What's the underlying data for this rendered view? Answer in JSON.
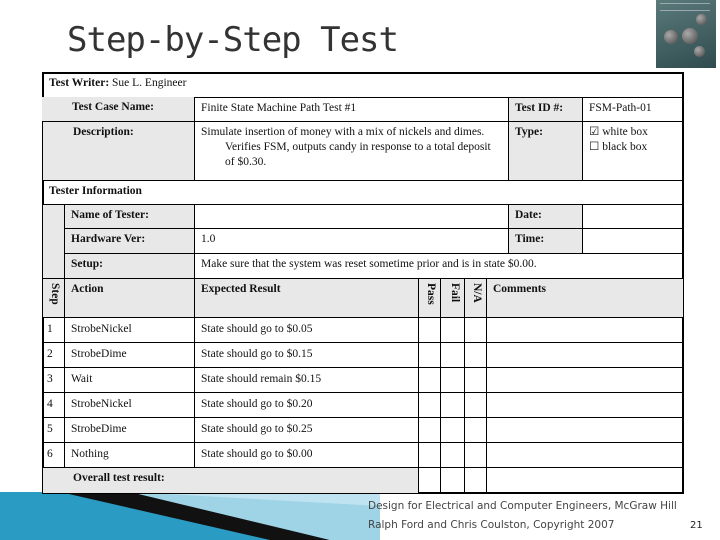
{
  "title": "Step-by-Step Test",
  "test_writer": {
    "label": "Test Writer:",
    "value": "Sue L. Engineer"
  },
  "test_case_name": {
    "label": "Test Case Name:",
    "value": "Finite State Machine Path Test #1"
  },
  "test_id": {
    "label": "Test ID #:",
    "value": "FSM-Path-01"
  },
  "description": {
    "label": "Description:",
    "value": "Simulate insertion of money with a mix of nickels and dimes. Verifies FSM, outputs candy in response to a total deposit of $0.30."
  },
  "type": {
    "label": "Type:",
    "options": [
      {
        "label": "white box",
        "checked": true,
        "box": "☑"
      },
      {
        "label": "black box",
        "checked": false,
        "box": "☐"
      }
    ]
  },
  "tester_info": {
    "label": "Tester Information",
    "name_label": "Name of Tester:",
    "name_value": "",
    "date_label": "Date:",
    "date_value": "",
    "hardware_label": "Hardware Ver:",
    "hardware_value": "1.0",
    "time_label": "Time:",
    "time_value": "",
    "setup_label": "Setup:",
    "setup_value": "Make sure that the system was reset sometime prior and is in state $0.00."
  },
  "steps_table": {
    "headers": {
      "step": "Step",
      "action": "Action",
      "expected": "Expected Result",
      "pass": "Pass",
      "fail": "Fail",
      "na": "N/A",
      "comments": "Comments"
    },
    "rows": [
      {
        "step": "1",
        "action": "StrobeNickel",
        "expected": "State should go to $0.05"
      },
      {
        "step": "2",
        "action": "StrobeDime",
        "expected": "State should go to $0.15"
      },
      {
        "step": "3",
        "action": "Wait",
        "expected": "State should remain $0.15"
      },
      {
        "step": "4",
        "action": "StrobeNickel",
        "expected": "State should go to $0.20"
      },
      {
        "step": "5",
        "action": "StrobeDime",
        "expected": "State should go to $0.25"
      },
      {
        "step": "6",
        "action": "Nothing",
        "expected": "State should go to $0.00"
      }
    ],
    "overall_label": "Overall test result:"
  },
  "footer": {
    "line1": "Design for Electrical and Computer Engineers, McGraw Hill",
    "line2": "Ralph Ford and Chris Coulston, Copyright 2007",
    "page_number": "21"
  },
  "colors": {
    "label_fill": "#e8e8e8",
    "swoosh": "#2a9cc4"
  }
}
